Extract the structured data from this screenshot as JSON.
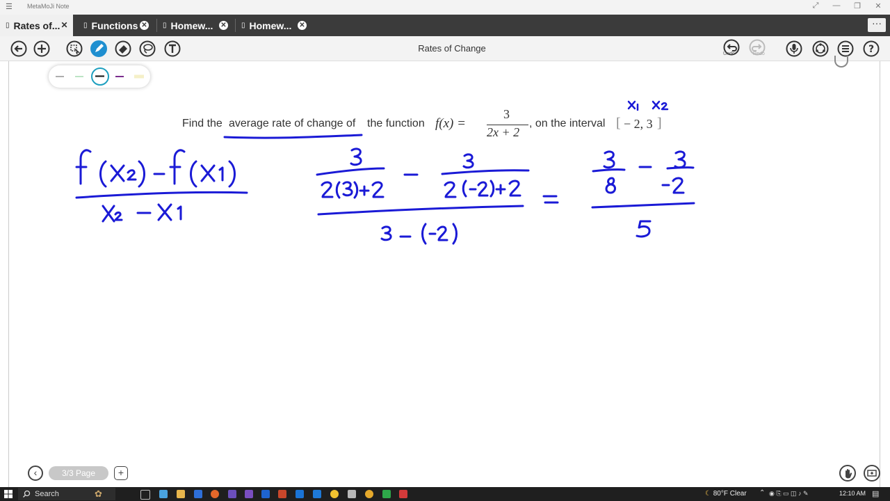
{
  "window": {
    "title": "MetaMoJi Note",
    "controls": [
      "⤢",
      "—",
      "❐",
      "✕"
    ]
  },
  "tabs": [
    {
      "label": "Rates of...",
      "active": true
    },
    {
      "label": "Functions",
      "active": false
    },
    {
      "label": "Homew...",
      "active": false
    },
    {
      "label": "Homew...",
      "active": false
    }
  ],
  "tab_menu": "···",
  "toolbar": {
    "document_title": "Rates of Change",
    "undo_label": "Undo",
    "redo_label": "Redo"
  },
  "palette": {
    "pens": [
      "#777777",
      "#8fd19e",
      "#222222",
      "#7b2d8e",
      "#f5f0c8"
    ],
    "selected": 2
  },
  "problem": {
    "prefix": "Find the",
    "link_text": "average rate of change of",
    "middle": "the function",
    "func": "f(x) =",
    "num": "3",
    "den": "2x + 2",
    "suffix": ", on the interval",
    "interval_open": "[",
    "interval_values": "− 2, 3",
    "interval_close": "]"
  },
  "handwriting": {
    "x_labels": [
      "x₁",
      "x₂"
    ],
    "formula_num": "f(x₂) − f(x₁)",
    "formula_den": "x₂ − x₁",
    "step1_num_a": "3",
    "step1_den_a": "2(3)+2",
    "step1_num_b": "3",
    "step1_den_b": "2(-2)+2",
    "step1_den": "3 − (−2)",
    "step2_num_a": "3",
    "step2_den_a": "8",
    "step2_num_b": "3",
    "step2_den_b": "-2",
    "step2_den": "5",
    "ink_color": "#1a1ad6"
  },
  "page_nav": {
    "indicator": "3/3 Page"
  },
  "taskbar": {
    "search_placeholder": "Search",
    "weather": "80°F  Clear",
    "time": "12:10 AM"
  }
}
